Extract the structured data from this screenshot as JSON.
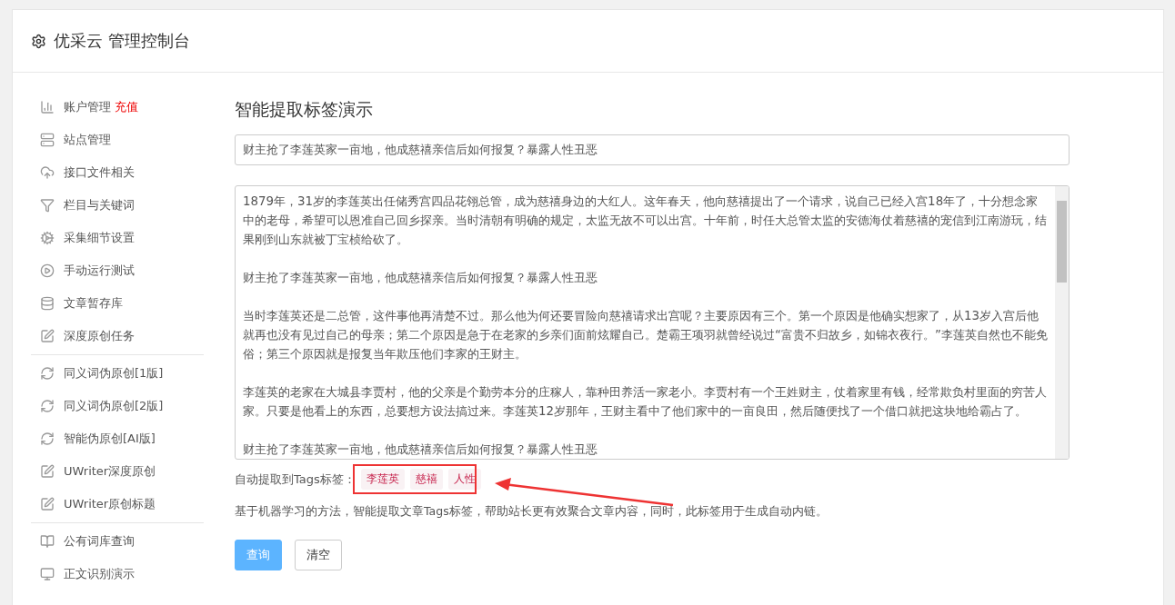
{
  "header": {
    "title": "优采云 管理控制台"
  },
  "sidebar": {
    "groups": [
      {
        "items": [
          {
            "label": "账户管理",
            "badge": "充值"
          },
          {
            "label": "站点管理"
          },
          {
            "label": "接口文件相关"
          },
          {
            "label": "栏目与关键词"
          },
          {
            "label": "采集细节设置"
          },
          {
            "label": "手动运行测试"
          },
          {
            "label": "文章暂存库"
          },
          {
            "label": "深度原创任务"
          }
        ]
      },
      {
        "items": [
          {
            "label": "同义词伪原创[1版]"
          },
          {
            "label": "同义词伪原创[2版]"
          },
          {
            "label": "智能伪原创[AI版]"
          },
          {
            "label": "UWriter深度原创"
          },
          {
            "label": "UWriter原创标题"
          }
        ]
      },
      {
        "items": [
          {
            "label": "公有词库查询"
          },
          {
            "label": "正文识别演示"
          }
        ]
      }
    ]
  },
  "main": {
    "title": "智能提取标签演示",
    "title_field": {
      "value": "财主抢了李莲英家一亩地，他成慈禧亲信后如何报复？暴露人性丑恶"
    },
    "content_field": {
      "paragraphs": [
        "1879年，31岁的李莲英出任储秀宫四品花翎总管，成为慈禧身边的大红人。这年春天，他向慈禧提出了一个请求，说自己已经入宫18年了，十分想念家中的老母，希望可以恩准自己回乡探亲。当时清朝有明确的规定，太监无故不可以出宫。十年前，时任大总管太监的安德海仗着慈禧的宠信到江南游玩，结果刚到山东就被丁宝桢给砍了。",
        "财主抢了李莲英家一亩地，他成慈禧亲信后如何报复？暴露人性丑恶",
        "当时李莲英还是二总管，这件事他再清楚不过。那么他为何还要冒险向慈禧请求出宫呢？主要原因有三个。第一个原因是他确实想家了，从13岁入宫后他就再也没有见过自己的母亲；第二个原因是急于在老家的乡亲们面前炫耀自己。楚霸王项羽就曾经说过“富贵不归故乡，如锦衣夜行。”李莲英自然也不能免俗；第三个原因就是报复当年欺压他们李家的王财主。",
        "李莲英的老家在大城县李贾村，他的父亲是个勤劳本分的庄稼人，靠种田养活一家老小。李贾村有一个王姓财主，仗着家里有钱，经常欺负村里面的穷苦人家。只要是他看上的东西，总要想方设法搞过来。李莲英12岁那年，王财主看中了他们家中的一亩良田，然后随便找了一个借口就把这块地给霸占了。",
        "财主抢了李莲英家一亩地，他成慈禧亲信后如何报复？暴露人性丑恶"
      ]
    },
    "tags_label": "自动提取到Tags标签：",
    "tags": [
      "李莲英",
      "慈禧",
      "人性"
    ],
    "description": "基于机器学习的方法，智能提取文章Tags标签，帮助站长更有效聚合文章内容，同时，此标签用于生成自动内链。",
    "buttons": [
      {
        "label": "查询",
        "kind": "primary"
      },
      {
        "label": "清空",
        "kind": "default"
      }
    ]
  }
}
